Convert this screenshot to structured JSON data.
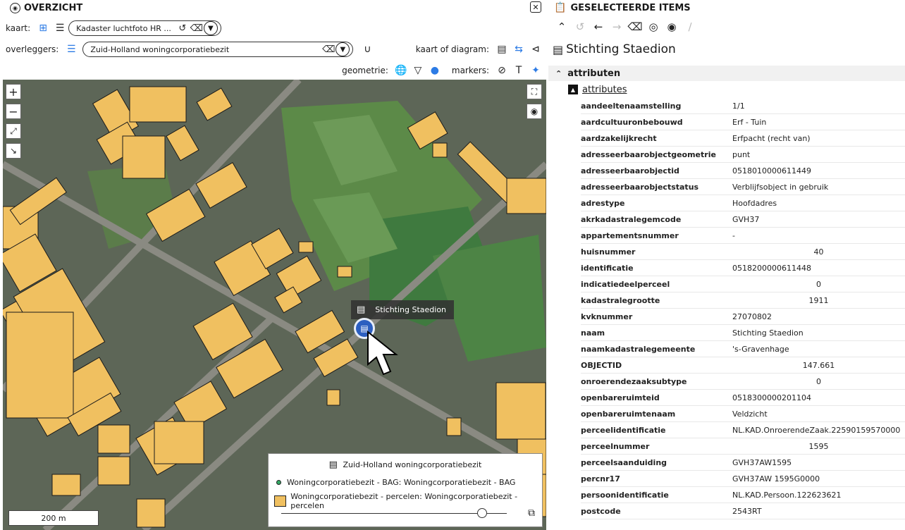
{
  "left": {
    "title": "OVERZICHT",
    "close": "✕",
    "kaart_label": "kaart:",
    "kaart_value": "Kadaster luchtfoto HR ...",
    "overleggers_label": "overleggers:",
    "overleggers_value": "Zuid-Holland woningcorporatiebezit",
    "kaart_of_diagram_label": "kaart of diagram:",
    "geometrie_label": "geometrie:",
    "markers_label": "markers:"
  },
  "map": {
    "popup_text": "Stichting Staedion",
    "scale_text": "200 m",
    "legend": {
      "title": "Zuid-Holland woningcorporatiebezit",
      "items": [
        "Woningcorporatiebezit - BAG: Woningcorporatiebezit - BAG",
        "Woningcorporatiebezit - percelen: Woningcorporatiebezit - percelen"
      ],
      "slider_value": 0.91
    },
    "colors": {
      "parcel_fill": "#f0c060",
      "marker": "#2c5fc0"
    }
  },
  "right": {
    "title": "GESELECTEERDE ITEMS",
    "item_name": "Stichting Staedion",
    "section": "attributen",
    "subsection": "attributes",
    "attributes": [
      {
        "k": "aandeeltenaamstelling",
        "v": "1/1"
      },
      {
        "k": "aardcultuuronbebouwd",
        "v": "Erf - Tuin"
      },
      {
        "k": "aardzakelijkrecht",
        "v": "Erfpacht (recht van)"
      },
      {
        "k": "adresseerbaarobjectgeometrie",
        "v": "punt"
      },
      {
        "k": "adresseerbaarobjectid",
        "v": "0518010000611449"
      },
      {
        "k": "adresseerbaarobjectstatus",
        "v": "Verblijfsobject in gebruik"
      },
      {
        "k": "adrestype",
        "v": "Hoofdadres"
      },
      {
        "k": "akrkadastralegemcode",
        "v": "GVH37"
      },
      {
        "k": "appartementsnummer",
        "v": "-"
      },
      {
        "k": "huisnummer",
        "v": "40"
      },
      {
        "k": "identificatie",
        "v": "0518200000611448"
      },
      {
        "k": "indicatiedeelperceel",
        "v": "0"
      },
      {
        "k": "kadastralegrootte",
        "v": "1911"
      },
      {
        "k": "kvknummer",
        "v": "27070802"
      },
      {
        "k": "naam",
        "v": "Stichting Staedion"
      },
      {
        "k": "naamkadastralegemeente",
        "v": "'s-Gravenhage"
      },
      {
        "k": "OBJECTID",
        "v": "147.661"
      },
      {
        "k": "onroerendezaaksubtype",
        "v": "0"
      },
      {
        "k": "openbareruimteid",
        "v": "0518300000201104"
      },
      {
        "k": "openbareruimtenaam",
        "v": "Veldzicht"
      },
      {
        "k": "perceelidentificatie",
        "v": "NL.KAD.OnroerendeZaak.22590159570000"
      },
      {
        "k": "perceelnummer",
        "v": "1595"
      },
      {
        "k": "perceelsaanduiding",
        "v": "GVH37AW1595"
      },
      {
        "k": "percnr17",
        "v": "GVH37AW 1595G0000"
      },
      {
        "k": "persoonidentificatie",
        "v": "NL.KAD.Persoon.122623621"
      },
      {
        "k": "postcode",
        "v": "2543RT"
      }
    ]
  }
}
